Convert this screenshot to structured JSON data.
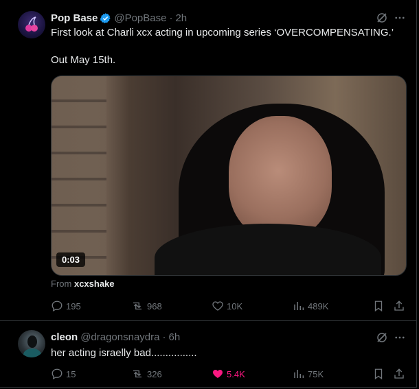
{
  "post": {
    "name": "Pop Base",
    "handle": "@PopBase",
    "separator": "·",
    "time": "2h",
    "text_line1": "First look at Charli xcx acting in upcoming series ‘OVERCOMPENSATING.’",
    "text_line2": "Out May 15th.",
    "video_duration": "0:03",
    "from_label": "From",
    "from_account": "xcxshake",
    "stats": {
      "replies": "195",
      "reposts": "968",
      "likes": "10K",
      "views": "489K"
    }
  },
  "reply": {
    "name": "cleon",
    "handle": "@dragonsnaydra",
    "separator": "·",
    "time": "6h",
    "text": "her acting israelly bad................",
    "stats": {
      "replies": "15",
      "reposts": "326",
      "likes": "5.4K",
      "views": "75K"
    },
    "liked": true
  },
  "colors": {
    "background": "#000000",
    "text": "#e7e9ea",
    "muted": "#71767b",
    "verified": "#1d9bf0",
    "like_active": "#f91880",
    "border": "#2f3336"
  },
  "icons": [
    "verified-badge-icon",
    "grok-icon",
    "more-icon",
    "reply-icon",
    "repost-icon",
    "like-icon",
    "views-icon",
    "bookmark-icon",
    "share-icon"
  ]
}
